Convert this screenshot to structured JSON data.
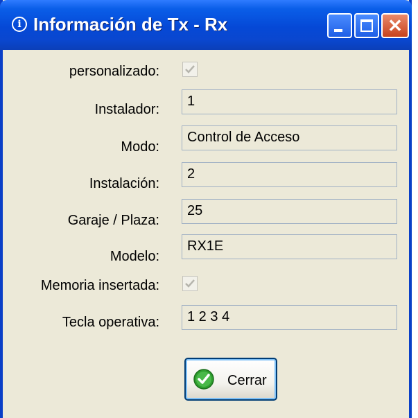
{
  "window": {
    "title": "Información de Tx - Rx",
    "title_icon_glyph": "i"
  },
  "fields": [
    {
      "label": "personalizado:",
      "type": "checkbox",
      "checked": true
    },
    {
      "label": "Instalador:",
      "type": "text",
      "value": "1"
    },
    {
      "label": "Modo:",
      "type": "text",
      "value": "Control de Acceso"
    },
    {
      "label": "Instalación:",
      "type": "text",
      "value": "2"
    },
    {
      "label": "Garaje / Plaza:",
      "type": "text",
      "value": "25"
    },
    {
      "label": "Modelo:",
      "type": "text",
      "value": "RX1E"
    },
    {
      "label": "Memoria insertada:",
      "type": "checkbox",
      "checked": true
    },
    {
      "label": "Tecla operativa:",
      "type": "text",
      "value": "1 2 3 4"
    }
  ],
  "close_button": {
    "label": "Cerrar",
    "icon": "green-check-icon"
  },
  "colors": {
    "titlebar": "#0548d6",
    "window_bg": "#ece9d8",
    "close_red": "#c8421c",
    "check_green": "#2e9e2e"
  }
}
